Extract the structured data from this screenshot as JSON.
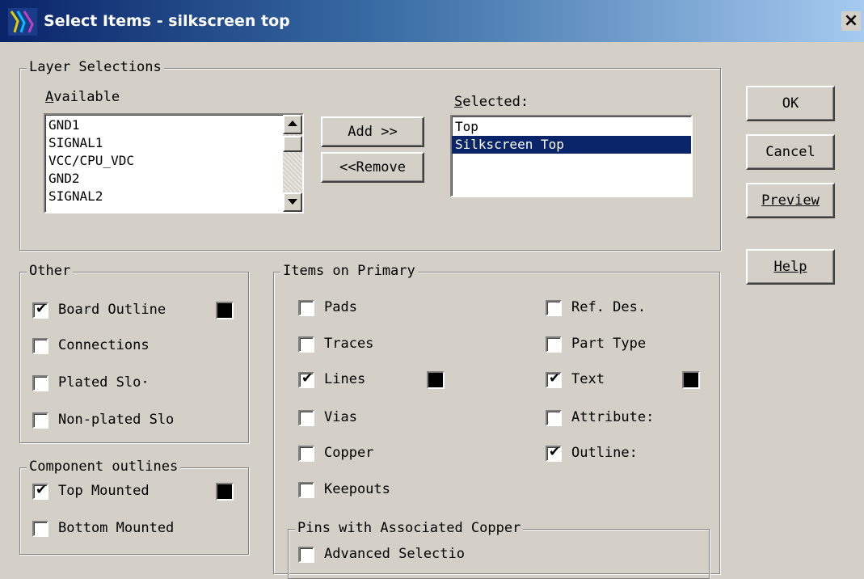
{
  "window": {
    "title": "Select Items - silkscreen top",
    "close_label": "×"
  },
  "layer_selections": {
    "legend": "Layer Selections",
    "available_label": "Available",
    "available_items": [
      "GND1",
      "SIGNAL1",
      "VCC/CPU_VDC",
      "GND2",
      "SIGNAL2"
    ],
    "selected_label": "Selected:",
    "selected_items": [
      "Top",
      "Silkscreen Top"
    ],
    "selected_highlight": "Silkscreen Top",
    "add_label": "Add >>",
    "remove_label": "<<Remove"
  },
  "buttons": {
    "ok": "OK",
    "cancel": "Cancel",
    "preview": "Preview",
    "help": "Help"
  },
  "other": {
    "legend": "Other",
    "items": [
      {
        "label": "Board Outline",
        "checked": true,
        "color": "#000000"
      },
      {
        "label": "Connections",
        "checked": false
      },
      {
        "label": "Plated Slo·",
        "checked": false
      },
      {
        "label": "Non-plated Slo",
        "checked": false
      }
    ]
  },
  "component_outlines": {
    "legend": "Component outlines",
    "items": [
      {
        "label": "Top Mounted",
        "checked": true,
        "color": "#000000"
      },
      {
        "label": "Bottom Mounted",
        "checked": false
      }
    ]
  },
  "items_on_primary": {
    "legend": "Items on Primary",
    "left": [
      {
        "label": "Pads",
        "checked": false
      },
      {
        "label": "Traces",
        "checked": false
      },
      {
        "label": "Lines",
        "checked": true,
        "color": "#000000"
      },
      {
        "label": "Vias",
        "checked": false
      },
      {
        "label": "Copper",
        "checked": false
      },
      {
        "label": "Keepouts",
        "checked": false
      }
    ],
    "right": [
      {
        "label": "Ref. Des.",
        "checked": false
      },
      {
        "label": "Part Type",
        "checked": false
      },
      {
        "label": "Text",
        "checked": true,
        "color": "#000000"
      },
      {
        "label": "Attribute:",
        "checked": false
      },
      {
        "label": "Outline:",
        "checked": true
      }
    ],
    "pins_legend": "Pins with Associated Copper",
    "advanced": {
      "label": "Advanced Selectio",
      "checked": false
    }
  },
  "check_glyph": "✔"
}
